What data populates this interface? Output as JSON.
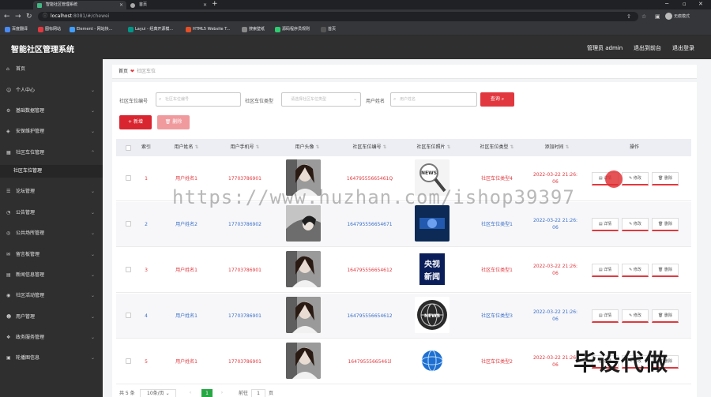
{
  "browser": {
    "tabs": [
      {
        "label": "智能社区管理系统",
        "active": true,
        "favicon_color": "#42b883"
      },
      {
        "label": "首页",
        "active": false,
        "favicon_color": "#aaaaaa"
      }
    ],
    "url_host": "localhost",
    "url_rest": ":8081/#/chewei",
    "profile": "无痕模式",
    "bookmarks": [
      {
        "label": "百度翻译",
        "color": "#4a8af4"
      },
      {
        "label": "图标网站",
        "color": "#e0383e"
      },
      {
        "label": "Element - 网站快...",
        "color": "#409eff"
      },
      {
        "label": "Layui - 经典开源模...",
        "color": "#009688"
      },
      {
        "label": "HTML5 Website T...",
        "color": "#e34f26"
      },
      {
        "label": "搜索壁纸",
        "color": "#888888"
      },
      {
        "label": "源码程序员规则",
        "color": "#2ecc71"
      },
      {
        "label": "首页",
        "color": "#555555"
      }
    ]
  },
  "header": {
    "title": "智能社区管理系统",
    "admin": "管理员 admin",
    "back_link": "退出到前台",
    "logout": "退出登录"
  },
  "sidebar": {
    "items": [
      {
        "label": "首页",
        "icon": "home-icon",
        "arrow": false
      },
      {
        "label": "个人中心",
        "icon": "user-icon",
        "arrow": true
      },
      {
        "label": "基础数据管理",
        "icon": "gear-icon",
        "arrow": true
      },
      {
        "label": "安保维护管理",
        "icon": "shield-icon",
        "arrow": true
      },
      {
        "label": "社区车位管理",
        "icon": "parking-icon",
        "arrow": true
      },
      {
        "label": "社区车位管理",
        "icon": "",
        "arrow": false,
        "sub": true
      },
      {
        "label": "论坛管理",
        "icon": "forum-icon",
        "arrow": true
      },
      {
        "label": "公告管理",
        "icon": "notice-icon",
        "arrow": true
      },
      {
        "label": "公共场所管理",
        "icon": "place-icon",
        "arrow": true
      },
      {
        "label": "留言板管理",
        "icon": "message-icon",
        "arrow": true
      },
      {
        "label": "新闻信息管理",
        "icon": "news-icon",
        "arrow": true
      },
      {
        "label": "社区活动管理",
        "icon": "activity-icon",
        "arrow": true
      },
      {
        "label": "用户管理",
        "icon": "users-icon",
        "arrow": true
      },
      {
        "label": "政务服务管理",
        "icon": "service-icon",
        "arrow": true
      },
      {
        "label": "轮播图信息",
        "icon": "carousel-icon",
        "arrow": true
      }
    ]
  },
  "breadcrumb": {
    "home": "首页",
    "current": "社区车位"
  },
  "search": {
    "label1": "社区车位编号",
    "placeholder1": "社区车位编号",
    "label2": "社区车位类型",
    "placeholder2": "请选择社区车位类型",
    "label3": "用户姓名",
    "placeholder3": "用户姓名",
    "button": "查询"
  },
  "actions": {
    "add": "新增",
    "delete": "删除"
  },
  "table": {
    "headers": [
      "索引",
      "用户姓名",
      "用户手机号",
      "用户头像",
      "社区车位编号",
      "社区车位照片",
      "社区车位类型",
      "添加时间",
      "操作"
    ],
    "rows": [
      {
        "index": "1",
        "name": "用户姓名1",
        "phone": "17703786901",
        "code": "16479555665461Q",
        "type": "社区车位类型4",
        "time1": "2022-03-22 21:26:",
        "time2": "06",
        "photo": "news-magnifier",
        "color": "red"
      },
      {
        "index": "2",
        "name": "用户姓名2",
        "phone": "17703786902",
        "code": "164795556654671",
        "type": "社区车位类型1",
        "time1": "2022-03-22 21:26:",
        "time2": "06",
        "photo": "news-blue",
        "color": "blue"
      },
      {
        "index": "3",
        "name": "用户姓名1",
        "phone": "17703786901",
        "code": "164795556654612",
        "type": "社区车位类型1",
        "time1": "2022-03-22 21:26:",
        "time2": "06",
        "photo": "cctv-news",
        "color": "red"
      },
      {
        "index": "4",
        "name": "用户姓名1",
        "phone": "17703786901",
        "code": "164795556654612",
        "type": "社区车位类型3",
        "time1": "2022-03-22 21:26:",
        "time2": "06",
        "photo": "news-globe-dark",
        "color": "blue"
      },
      {
        "index": "5",
        "name": "用户姓名1",
        "phone": "17703786901",
        "code": "16479555665461l",
        "type": "社区车位类型2",
        "time1": "2022-03-22 21:26:",
        "time2": "06",
        "photo": "news-globe-blue",
        "color": "red"
      }
    ],
    "op_detail": "详情",
    "op_edit": "修改",
    "op_delete": "删除"
  },
  "pager": {
    "total": "共 5 条",
    "size": "10条/页",
    "page": "1",
    "goto": "前往",
    "goto_page": "1",
    "unit": "页"
  },
  "watermark": "https://www.huzhan.com/ishop39397",
  "promo": "毕设代做"
}
